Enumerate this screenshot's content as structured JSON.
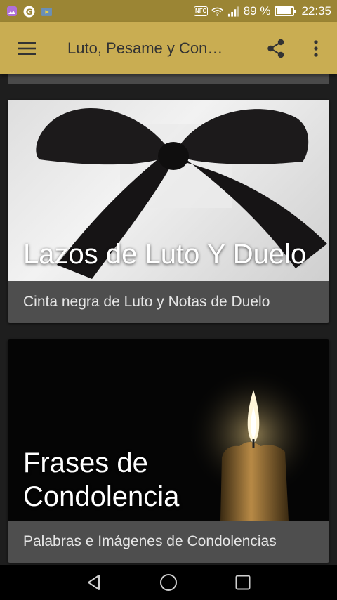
{
  "status_bar": {
    "battery_percent": "89 %",
    "battery_level": 0.89,
    "time": "22:35",
    "nfc": "NFC",
    "icons": [
      "gallery-icon",
      "google-icon",
      "play-store-icon",
      "nfc-icon",
      "wifi-icon",
      "signal-icon",
      "battery-icon"
    ]
  },
  "app_bar": {
    "title": "Luto, Pesame y Con…",
    "icons": [
      "hamburger-menu-icon",
      "share-icon",
      "more-vert-icon"
    ],
    "background": "#c9ad52"
  },
  "cards": [
    {
      "title": "Lazos de Luto Y Duelo",
      "subtitle": "Cinta negra de Luto y Notas de Duelo",
      "image": "black-ribbon-bow"
    },
    {
      "title": "Frases de Condolencia",
      "subtitle": "Palabras e Imágenes de Condolencias",
      "image": "lit-candle"
    }
  ],
  "nav_bar": {
    "icons": [
      "back-icon",
      "home-icon",
      "recents-icon"
    ]
  }
}
